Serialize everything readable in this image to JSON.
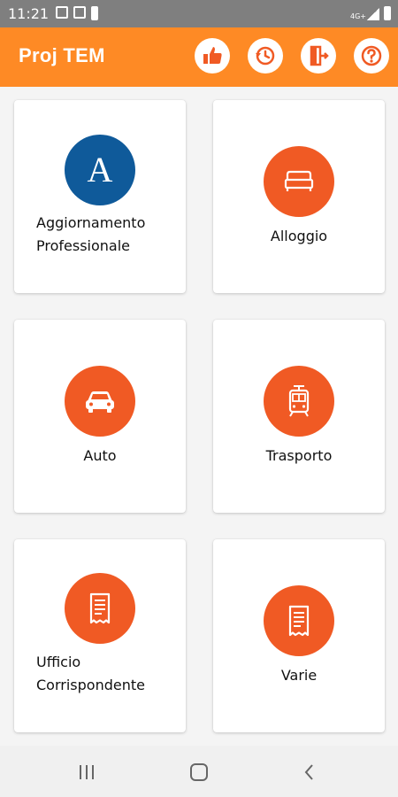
{
  "status_bar": {
    "time": "11:21",
    "network_label": "4G+"
  },
  "app": {
    "title": "Proj TEM",
    "accent": "#fe8a25"
  },
  "toolbar": {
    "actions": [
      {
        "icon": "thumbs-up-icon"
      },
      {
        "icon": "history-icon"
      },
      {
        "icon": "logout-door-icon"
      },
      {
        "icon": "help-icon"
      }
    ]
  },
  "categories": [
    {
      "label_line1": "Aggiornamento",
      "label_line2": "Professionale",
      "icon": "letter-a-logo",
      "icon_letter": "A",
      "color": "#0f5a9a"
    },
    {
      "label": "Alloggio",
      "icon": "bed-icon",
      "color": "#f05a24"
    },
    {
      "label": "Auto",
      "icon": "car-icon",
      "color": "#f05a24"
    },
    {
      "label": "Trasporto",
      "icon": "tram-icon",
      "color": "#f05a24"
    },
    {
      "label_line1": "Ufficio",
      "label_line2": "Corrispondente",
      "icon": "receipt-icon",
      "color": "#f05a24"
    },
    {
      "label": "Varie",
      "icon": "receipt-icon",
      "color": "#f05a24"
    }
  ],
  "navigation": [
    {
      "icon": "recent-apps-icon"
    },
    {
      "icon": "home-icon"
    },
    {
      "icon": "back-icon"
    }
  ]
}
